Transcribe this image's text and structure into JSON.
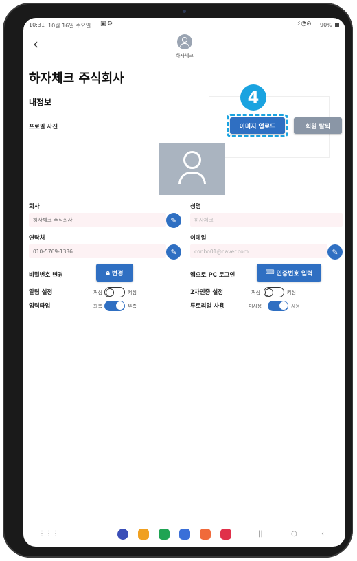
{
  "status_bar": {
    "time": "10:31",
    "date": "10월 16일 수요일",
    "right": "90%"
  },
  "header": {
    "back_label": "‹",
    "avatar_caption": "하자체크"
  },
  "page": {
    "company_title": "하자체크 주식회사",
    "section_title": "내정보"
  },
  "profile": {
    "label": "프로필 사진",
    "upload_button": "이미지 업로드",
    "withdraw_button": "회원 탈퇴",
    "step_number": "4"
  },
  "form": {
    "company": {
      "label": "회사",
      "value": "하자체크 주식회사"
    },
    "name": {
      "label": "성명",
      "value": "하자체크"
    },
    "phone": {
      "label": "연락처",
      "value": "010-5769-1336"
    },
    "email": {
      "label": "이메일",
      "value": "conbo01@naver.com"
    }
  },
  "settings": {
    "password": {
      "label": "비밀번호 변경",
      "button": "변경"
    },
    "pc_login": {
      "label": "앱으로 PC 로그인",
      "button": "인증번호 입력"
    },
    "alarm": {
      "label": "알림 설정",
      "off": "꺼짐",
      "on": "켜짐",
      "enabled": false
    },
    "two_factor": {
      "label": "2차인증 설정",
      "off": "꺼짐",
      "on": "켜짐",
      "enabled": false
    },
    "input_type": {
      "label": "입력타입",
      "off": "좌측",
      "on": "우측",
      "enabled": true
    },
    "tutorial": {
      "label": "튜토리얼 사용",
      "off": "미사용",
      "on": "사용",
      "enabled": true
    }
  },
  "colors": {
    "primary": "#2f6fc2",
    "gray_button": "#8a96a6",
    "highlight": "#1aa3e0",
    "field_bg": "#fdf2f4"
  },
  "nav_bar": {
    "apps": [
      "samsung-internet-icon",
      "folder-icon",
      "phone-icon",
      "messages-icon",
      "contacts-icon",
      "video-icon"
    ],
    "system": [
      "recents-icon",
      "home-icon",
      "back-icon"
    ]
  }
}
